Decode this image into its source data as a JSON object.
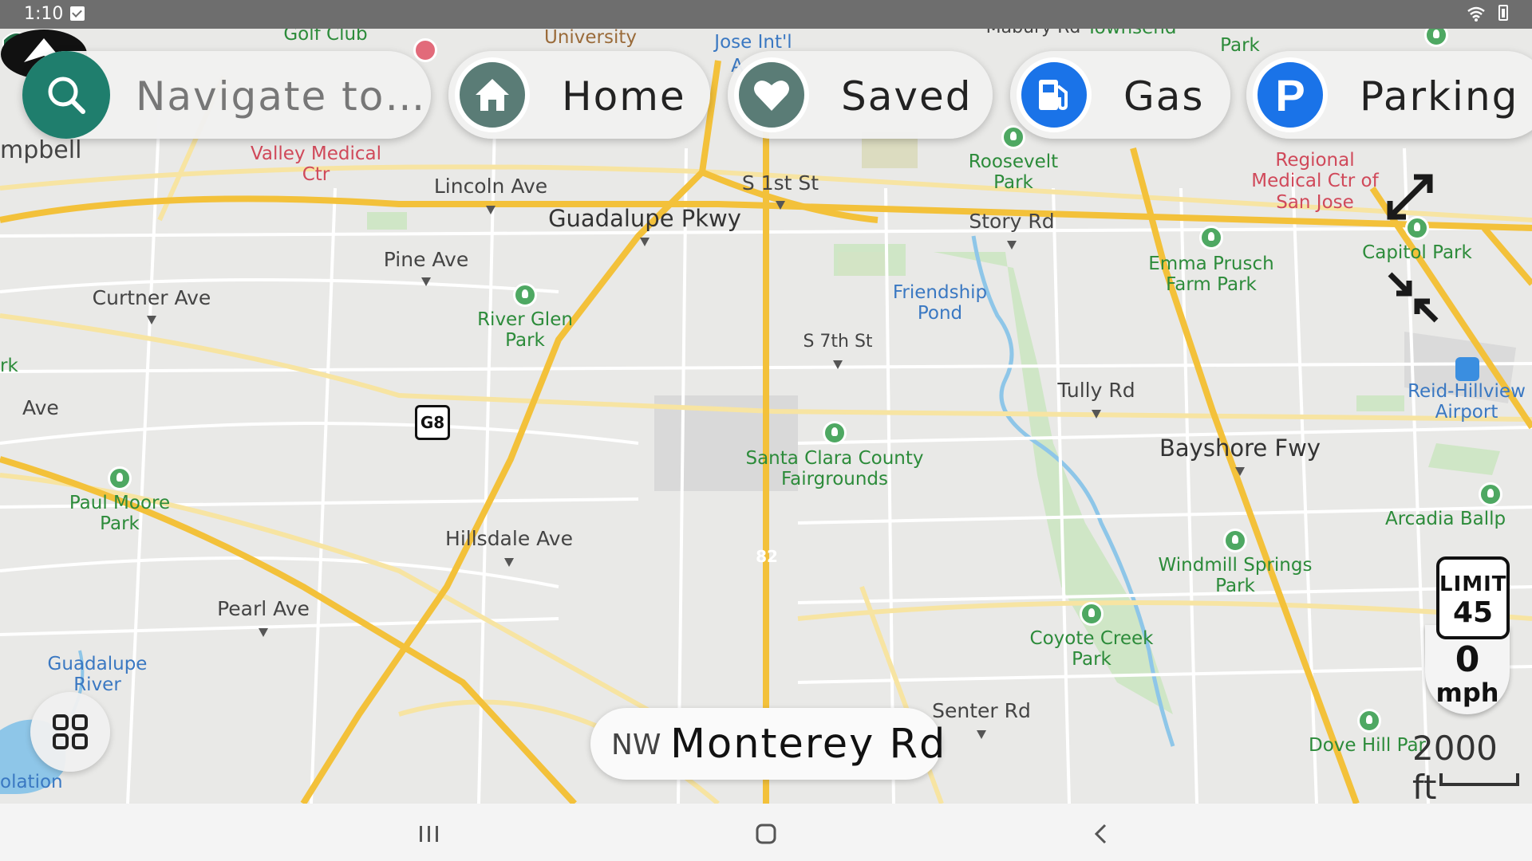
{
  "status_bar": {
    "time": "1:10"
  },
  "top_bar": {
    "search_placeholder": "Navigate to…",
    "home_label": "Home",
    "saved_label": "Saved",
    "gas_label": "Gas",
    "parking_label": "Parking"
  },
  "colors": {
    "search_accent": "#1f7e6d",
    "home_circle": "#5a7c76",
    "saved_circle": "#5a7c76",
    "gas_circle": "#1a73e8",
    "parking_circle": "#1a73e8",
    "highway": "#f3c13a",
    "park_green": "#cfe6c6",
    "water_blue": "#8ec6e8"
  },
  "map": {
    "roads": [
      "Lincoln Ave",
      "Guadalupe Pkwy",
      "S 1st St",
      "Story Rd",
      "Pine Ave",
      "Curtner Ave",
      "S 7th St",
      "Tully Rd",
      "Bayshore Fwy",
      "Hillsdale Ave",
      "Pearl Ave",
      "Senter Rd",
      "Jose Int'l",
      "Mabury Rd",
      "Townsend",
      "Ave",
      "rk",
      "mpbell",
      "A"
    ],
    "parks": [
      "Golf Club",
      "Roosevelt Park",
      "River Glen Park",
      "Emma Prusch Farm Park",
      "Capitol Park",
      "Santa Clara County Fairgrounds",
      "Paul Moore Park",
      "Windmill Springs Park",
      "Coyote Creek Park",
      "Arcadia Ballp",
      "Dove Hill Par",
      "Park"
    ],
    "water": [
      "Friendship Pond",
      "Guadalupe River",
      "Reid-Hillview Airport",
      "olation"
    ],
    "medical": [
      "Valley Medical Ctr",
      "Regional Medical Ctr of San Jose"
    ],
    "misc": [
      "University"
    ],
    "shields": {
      "route_82": "82",
      "g8": "G8"
    }
  },
  "street": {
    "direction": "NW",
    "name": "Monterey Rd"
  },
  "speed": {
    "limit_label": "LIMIT",
    "limit_value": "45",
    "current_value": "0",
    "unit": "mph"
  },
  "scale": {
    "label": "2000 ft"
  },
  "icons": [
    "search-icon",
    "home-icon",
    "heart-icon",
    "gas-station-icon",
    "parking-icon",
    "expand-icon",
    "collapse-icon",
    "grid-icon",
    "vehicle-arrow-icon",
    "recent-apps-icon",
    "home-nav-icon",
    "back-icon",
    "wifi-icon",
    "battery-icon",
    "checkbox-icon"
  ]
}
